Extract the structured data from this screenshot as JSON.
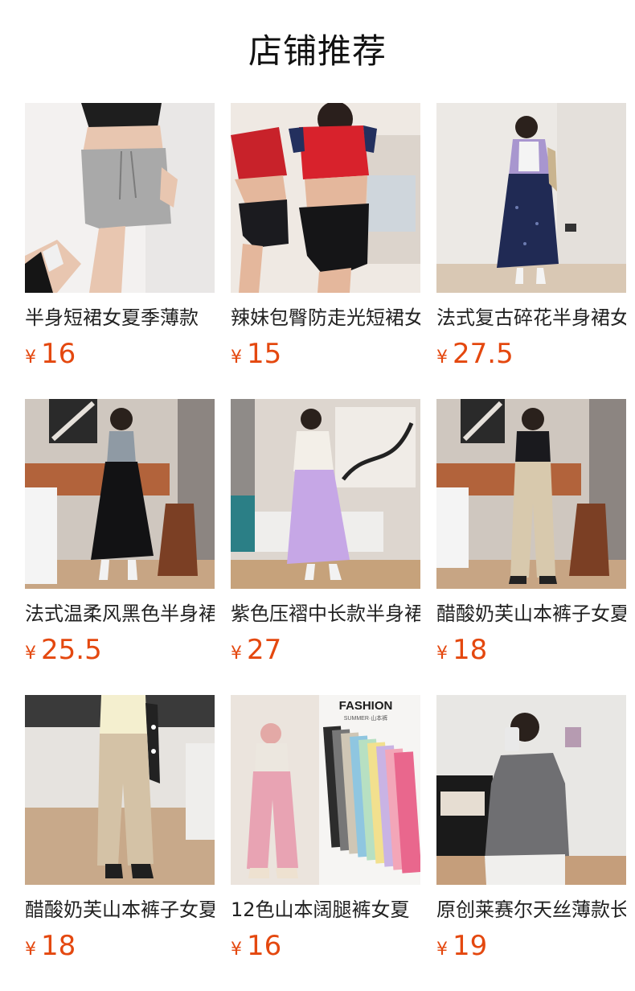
{
  "header": {
    "title": "店铺推荐"
  },
  "products": [
    {
      "name": "半身短裙女夏季薄款",
      "currency": "¥",
      "price": "16",
      "image": "grey-mini-skirt-photo"
    },
    {
      "name": "辣妹包臀防走光短裙女",
      "currency": "¥",
      "price": "15",
      "image": "black-asymmetric-skirt-photo"
    },
    {
      "name": "法式复古碎花半身裙女",
      "currency": "¥",
      "price": "27.5",
      "image": "navy-floral-maxi-skirt-photo"
    },
    {
      "name": "法式温柔风黑色半身裙",
      "currency": "¥",
      "price": "25.5",
      "image": "black-tiered-skirt-photo"
    },
    {
      "name": "紫色压褶中长款半身裙",
      "currency": "¥",
      "price": "27",
      "image": "purple-pleated-skirt-photo"
    },
    {
      "name": "醋酸奶芙山本裤子女夏",
      "currency": "¥",
      "price": "18",
      "image": "beige-wide-pants-photo"
    },
    {
      "name": "醋酸奶芙山本裤子女夏",
      "currency": "¥",
      "price": "18",
      "image": "tan-pants-photo"
    },
    {
      "name": "12色山本阔腿裤女夏",
      "currency": "¥",
      "price": "16",
      "image": "pink-pants-color-options-photo",
      "image_text": {
        "brand": "FASHION",
        "sub": "SUMMER·山本裤"
      }
    },
    {
      "name": "原创莱赛尔天丝薄款长袖",
      "currency": "¥",
      "price": "19",
      "image": "grey-long-sleeve-top-photo"
    }
  ]
}
